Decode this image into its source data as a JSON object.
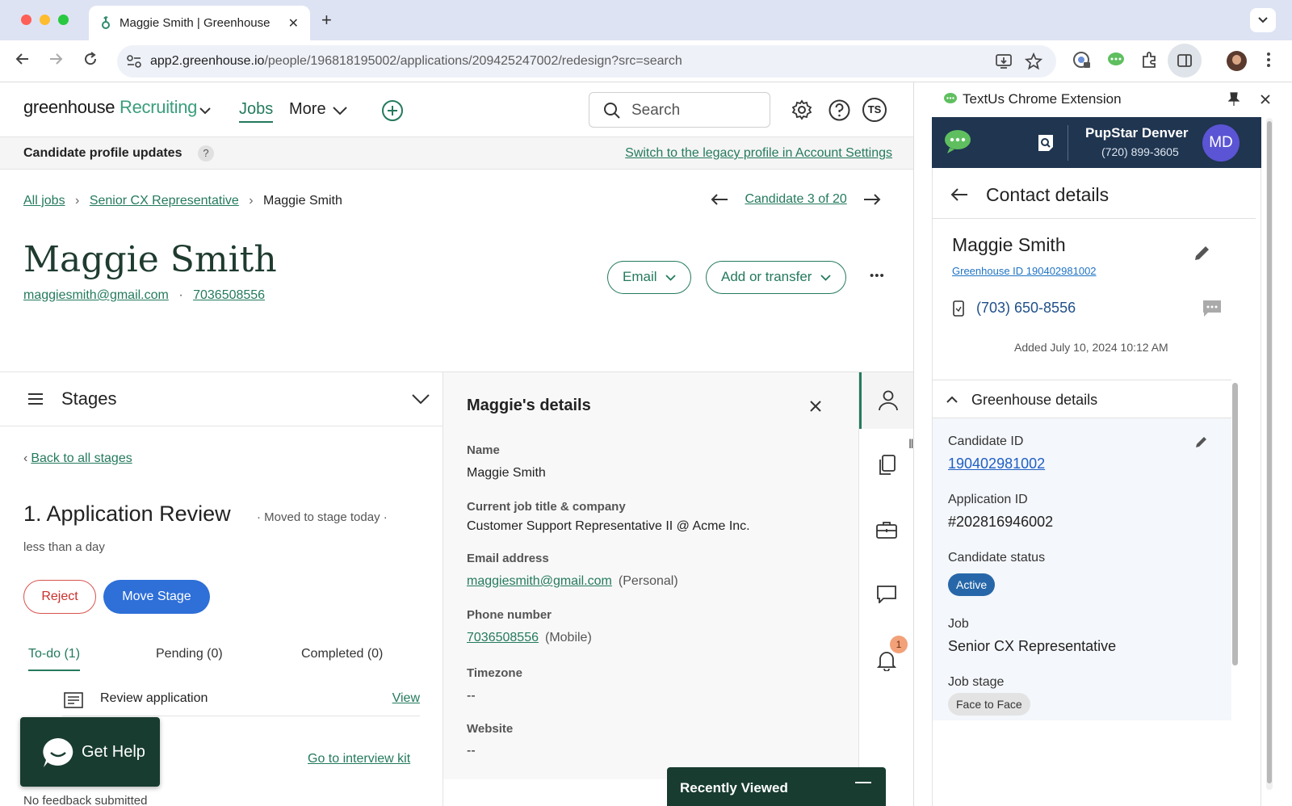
{
  "browser": {
    "tab_title": "Maggie Smith | Greenhouse",
    "url_host": "app2.greenhouse.io",
    "url_path": "/people/196818195002/applications/209425247002/redesign?src=search"
  },
  "header": {
    "logo_main": "greenhouse",
    "logo_sub": "Recruiting",
    "nav_jobs": "Jobs",
    "nav_more": "More",
    "search_placeholder": "Search",
    "avatar_initials": "TS"
  },
  "banner": {
    "title": "Candidate profile updates",
    "help": "?",
    "link": "Switch to the legacy profile in Account Settings"
  },
  "breadcrumb": {
    "all_jobs": "All jobs",
    "job": "Senior CX Representative",
    "current": "Maggie Smith"
  },
  "candidate_nav": "Candidate 3 of 20",
  "candidate": {
    "name": "Maggie Smith",
    "email": "maggiesmith@gmail.com",
    "dot": "·",
    "phone": "7036508556",
    "email_button": "Email",
    "add_transfer_button": "Add or transfer",
    "more_button": "•••"
  },
  "stages": {
    "title": "Stages",
    "back_link": "Back to all stages",
    "stage_name": "1. Application Review",
    "stage_sub": "· Moved to stage today ·",
    "stage_sub2": "less than a day",
    "reject": "Reject",
    "move_stage": "Move Stage",
    "tabs": [
      "To-do (1)",
      "Pending (0)",
      "Completed (0)"
    ],
    "task": "Review application",
    "task_link": "View",
    "interview_kit": "Go to interview kit",
    "no_feedback": "No feedback submitted"
  },
  "details": {
    "title": "Maggie's details",
    "fields": [
      {
        "label": "Name",
        "value": "Maggie Smith",
        "note": ""
      },
      {
        "label": "Current job title & company",
        "value": "Customer Support Representative II @ Acme Inc.",
        "note": ""
      },
      {
        "label": "Email address",
        "value": "maggiesmith@gmail.com",
        "note": "(Personal)"
      },
      {
        "label": "Phone number",
        "value": "7036508556",
        "note": "(Mobile)"
      },
      {
        "label": "Timezone",
        "value": "--",
        "note": ""
      },
      {
        "label": "Website",
        "value": "--",
        "note": ""
      }
    ]
  },
  "rail": {
    "icons": [
      "person-icon",
      "documents-icon",
      "briefcase-icon",
      "chat-icon",
      "bell-icon"
    ],
    "bell_badge": "1"
  },
  "get_help": "Get Help",
  "recently_viewed": "Recently Viewed",
  "extension": {
    "title": "TextUs Chrome Extension",
    "account_name": "PupStar Denver",
    "account_phone": "(720) 899-3605",
    "avatar": "MD",
    "section_title": "Contact details",
    "contact_name": "Maggie Smith",
    "greenhouse_id": "Greenhouse ID 190402981002",
    "contact_phone": "(703) 650-8556",
    "added": "Added July 10, 2024 10:12 AM",
    "gh_details_title": "Greenhouse details",
    "candidate_id_label": "Candidate ID",
    "candidate_id": "190402981002",
    "application_id_label": "Application ID",
    "application_id": "#202816946002",
    "status_label": "Candidate status",
    "status": "Active",
    "job_label": "Job",
    "job": "Senior CX Representative",
    "stage_label": "Job stage",
    "stage": "Face to Face"
  },
  "colors": {
    "brand_green": "#247a5d",
    "dark_green": "#183c30",
    "move_blue": "#2e6fd8",
    "reject_red": "#c9302c",
    "ext_navy": "#1f3550"
  }
}
